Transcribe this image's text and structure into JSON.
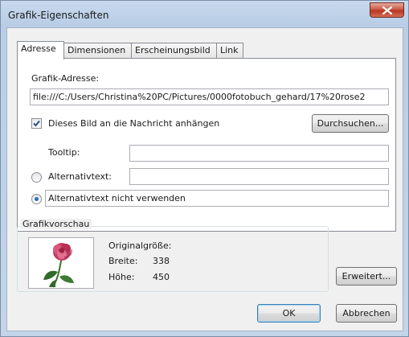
{
  "window": {
    "title": "Grafik-Eigenschaften"
  },
  "tabs": [
    {
      "label": "Adresse",
      "active": true
    },
    {
      "label": "Dimensionen",
      "active": false
    },
    {
      "label": "Erscheinungsbild",
      "active": false
    },
    {
      "label": "Link",
      "active": false
    }
  ],
  "address": {
    "section_label": "Grafik-Adresse:",
    "path_value": "file:///C:/Users/Christina%20PC/Pictures/0000fotobuch_gehard/17%20rose2",
    "attach_checkbox_label": "Dieses Bild an die Nachricht anhängen",
    "attach_checked": true,
    "browse_button": "Durchsuchen...",
    "tooltip_label": "Tooltip:",
    "tooltip_value": "",
    "alt_radio_label": "Alternativtext:",
    "alt_value": "",
    "no_alt_radio_label": "Alternativtext nicht verwenden",
    "selected_radio": "no_alt"
  },
  "preview": {
    "group_label": "Grafikvorschau",
    "original_size_label": "Originalgröße:",
    "width_label": "Breite:",
    "width_value": "338",
    "height_label": "Höhe:",
    "height_value": "450"
  },
  "buttons": {
    "advanced": "Erweitert...",
    "ok": "OK",
    "cancel": "Abbrechen"
  },
  "colors": {
    "titlebar": "#c8d9ee",
    "close_button": "#c7503c",
    "radio_selected": "#2b6fc2",
    "rose_petals": "#c23b63",
    "leaves": "#2f6b2a"
  }
}
